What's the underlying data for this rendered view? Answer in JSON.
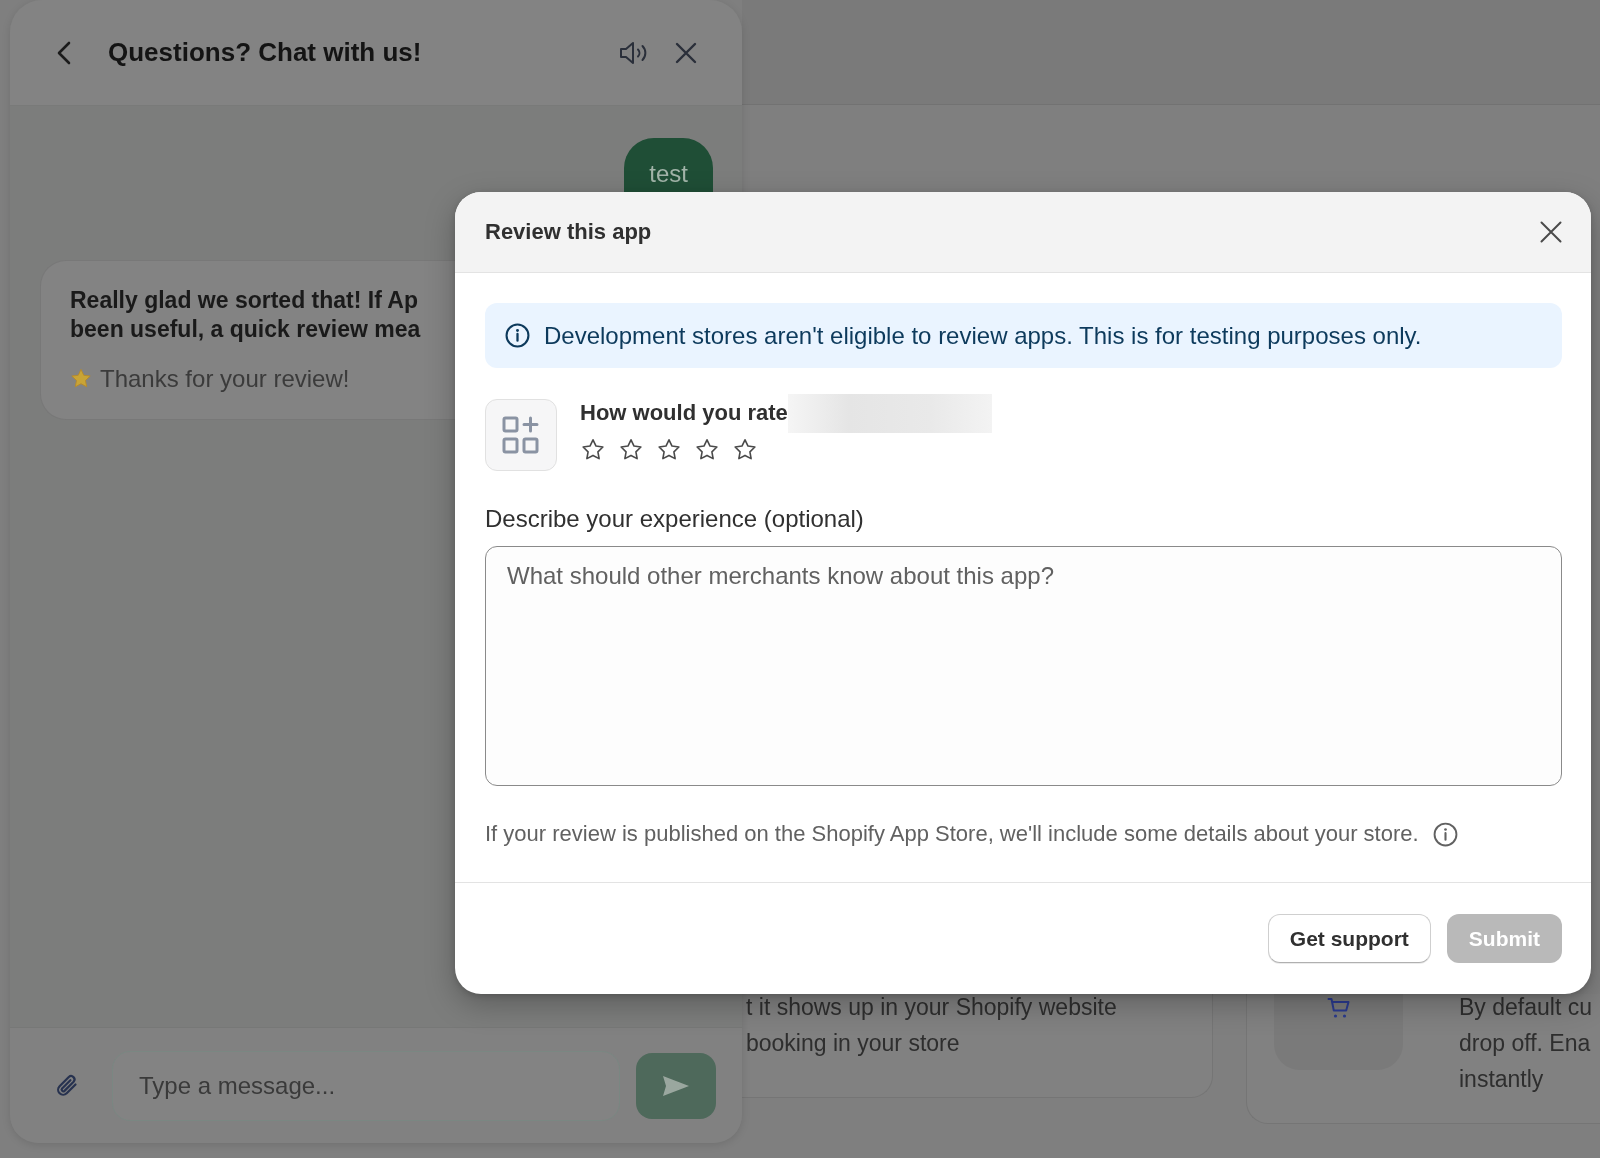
{
  "chat": {
    "title": "Questions? Chat with us!",
    "messages": [
      {
        "kind": "user",
        "text": "test"
      },
      {
        "kind": "bot",
        "lines": [
          "Really glad we sorted that! If Ap",
          "been useful, a quick review mea"
        ],
        "note": "Thanks for your review!"
      }
    ],
    "composer": {
      "placeholder": "Type a message..."
    }
  },
  "background_cards": [
    {
      "kind": "text",
      "lines": [
        "t it shows up in your Shopify website",
        "booking in your store"
      ]
    },
    {
      "kind": "icon",
      "lines": [
        "By default cu",
        "drop off. Ena",
        "instantly"
      ]
    }
  ],
  "review_dialog": {
    "title": "Review this app",
    "banner": {
      "text": "Development stores aren't eligible to review apps. This is for testing purposes only."
    },
    "rating": {
      "prompt": "How would you rate",
      "name_blurred": true,
      "stars": 0
    },
    "experience": {
      "label": "Describe your experience (optional)",
      "placeholder": "What should other merchants know about this app?"
    },
    "disclaimer": "If your review is published on the Shopify App Store, we'll include some details about your store.",
    "buttons": [
      {
        "label": "Get support",
        "kind": "secondary",
        "disabled": false
      },
      {
        "label": "Submit",
        "kind": "primary",
        "disabled": true
      }
    ]
  }
}
